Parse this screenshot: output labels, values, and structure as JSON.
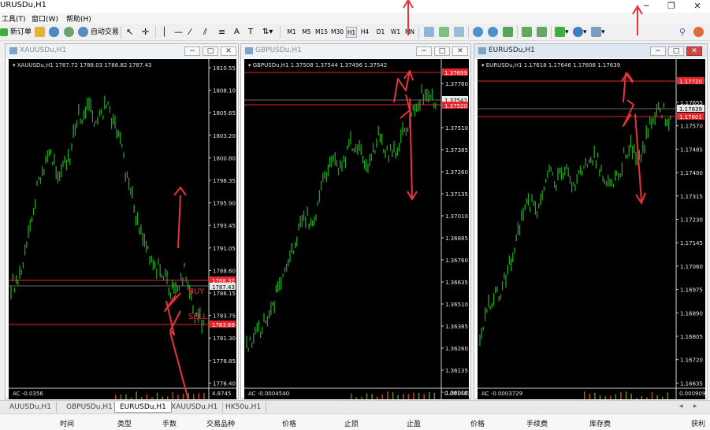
{
  "window": {
    "title": "URUSDu,H1"
  },
  "menu": [
    "工具(T)",
    "窗口(W)",
    "帮助(H)"
  ],
  "toolbar": {
    "new_order": "新订单",
    "auto_trading": "自动交易",
    "timeframes": [
      "M1",
      "M5",
      "M15",
      "M30",
      "H1",
      "H4",
      "D1",
      "W1",
      "MN"
    ]
  },
  "charts": [
    {
      "window_title": "XAUUSDu,H1",
      "info": "XAUUSDu,H1  1787.72 1788.03 1786.82 1787.43",
      "axis_labels": [
        "1810.55",
        "1808.10",
        "1805.65",
        "1803.20",
        "1800.80",
        "1798.35",
        "1795.90",
        "1793.45",
        "1791.05",
        "1788.60",
        "1786.15",
        "1783.75",
        "1781.30",
        "1778.85",
        "1776.40"
      ],
      "price_tags": [
        {
          "text": "1788.32",
          "color": "#e8262a"
        },
        {
          "text": "1787.43",
          "color": "#e8e8e8"
        },
        {
          "text": "1783.69",
          "color": "#e8262a"
        }
      ],
      "annotations": [
        "BUY",
        "SELL"
      ],
      "indicator": "AC -0.0356",
      "indicator_scale": "4.8745",
      "close_button_style": "normal"
    },
    {
      "window_title": "GBPUSDu,H1",
      "info": "GBPUSDu,H1  1.37508 1.37544 1.37496 1.37542",
      "axis_labels": [
        "1.37760",
        "1.37635",
        "1.37510",
        "1.37385",
        "1.37260",
        "1.37135",
        "1.37010",
        "1.36885",
        "1.36760",
        "1.36635",
        "1.36510",
        "1.36385",
        "1.36260",
        "1.36135",
        "1.36010"
      ],
      "price_tags": [
        {
          "text": "1.37699",
          "color": "#e8262a"
        },
        {
          "text": "1.37542",
          "color": "#e8e8e8"
        },
        {
          "text": "1.37520",
          "color": "#e8262a"
        }
      ],
      "indicator": "AC -0.0004540",
      "indicator_scale": "0.001483",
      "close_button_style": "normal"
    },
    {
      "window_title": "EURUSDu,H1",
      "info": "EURUSDu,H1  1.17618 1.17646 1.17608 1.17639",
      "axis_labels": [
        "1.17655",
        "1.17570",
        "1.17485",
        "1.17400",
        "1.17315",
        "1.17230",
        "1.17145",
        "1.17060",
        "1.16975",
        "1.16890",
        "1.16805",
        "1.16720",
        "1.16635"
      ],
      "price_tags": [
        {
          "text": "1.17720",
          "color": "#e8262a"
        },
        {
          "text": "1.17639",
          "color": "#e8e8e8"
        },
        {
          "text": "1.17601",
          "color": "#e8262a"
        }
      ],
      "indicator": "AC -0.0003729",
      "indicator_scale": "0.0009098",
      "close_button_style": "red"
    }
  ],
  "tabs": [
    {
      "label": "AUUSDu,H1",
      "active": false
    },
    {
      "label": "GBPUSDu,H1",
      "active": false
    },
    {
      "label": "EURUSDu,H1",
      "active": true
    },
    {
      "label": "XAUUSDu,H1",
      "active": false
    },
    {
      "label": "HK50u,H1",
      "active": false
    }
  ],
  "terminal_columns": [
    "时间",
    "类型",
    "手数",
    "交易品种",
    "价格",
    "止损",
    "止盈",
    "价格",
    "手续费",
    "库存费",
    "获利"
  ],
  "colors": {
    "chart_bg": "#000000",
    "candle": "#1fa31f",
    "level_line": "#e8262a",
    "annotation_arrow": "#e8333a"
  }
}
